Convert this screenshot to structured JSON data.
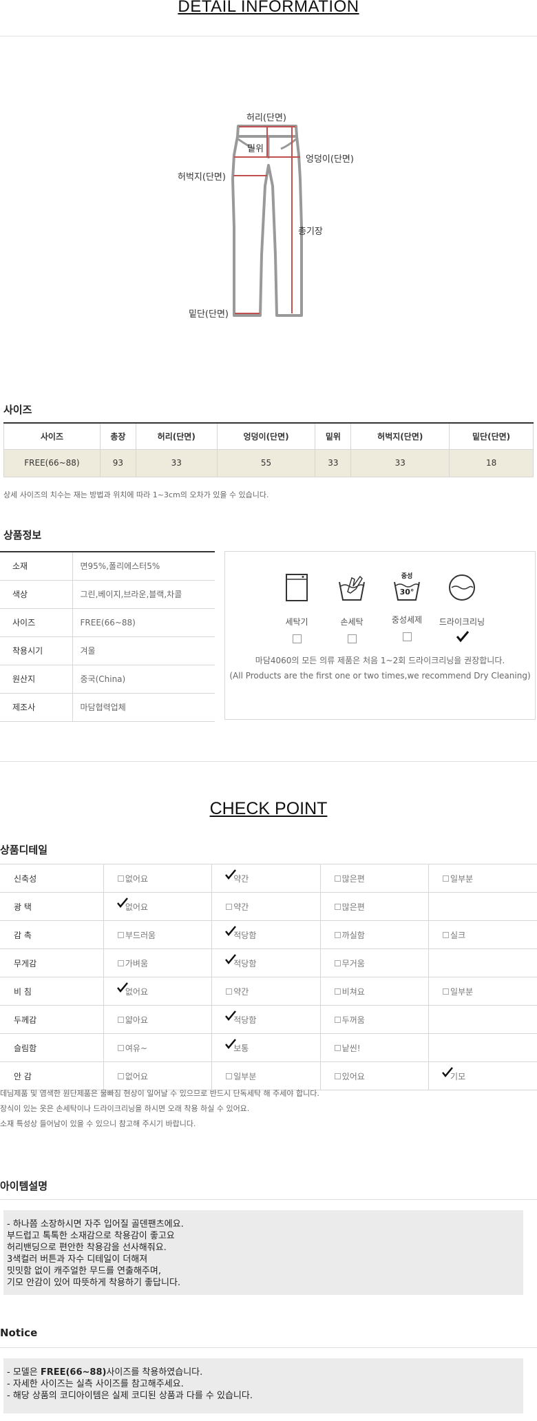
{
  "header": {
    "title": "DETAIL INFORMATION"
  },
  "diagram": {
    "labels": {
      "waist": "허리(단면)",
      "rise": "밑위",
      "hip": "엉덩이(단면)",
      "thigh": "허벅지(단면)",
      "length": "총기장",
      "hem": "밑단(단면)"
    }
  },
  "size_section": {
    "title": "사이즈",
    "headers": [
      "사이즈",
      "총장",
      "허리(단면)",
      "엉덩이(단면)",
      "밑위",
      "허벅지(단면)",
      "밑단(단면)"
    ],
    "row": [
      "FREE(66~88)",
      "93",
      "33",
      "55",
      "33",
      "33",
      "18"
    ],
    "note": "상세 사이즈의 치수는 재는 방법과 위치에 따라 1~3cm의 오차가 있을 수 있습니다."
  },
  "product_info": {
    "title": "상품정보",
    "rows": [
      {
        "key": "소재",
        "value": "면95%,폴리에스터5%"
      },
      {
        "key": "색상",
        "value": "그린,베이지,브라운,블랙,차콜"
      },
      {
        "key": "사이즈",
        "value": "FREE(66~88)"
      },
      {
        "key": "착용시기",
        "value": "겨울"
      },
      {
        "key": "원산지",
        "value": "중국(China)"
      },
      {
        "key": "제조사",
        "value": "마담협력업체"
      }
    ],
    "care": {
      "items": [
        {
          "label": "세탁기",
          "icon": "washing-machine-icon",
          "checked": false
        },
        {
          "label": "손세탁",
          "icon": "hand-wash-icon",
          "checked": false
        },
        {
          "label": "중성세제",
          "icon": "neutral-detergent-icon",
          "checked": false,
          "tag": "중성",
          "temp": "30°"
        },
        {
          "label": "드라이크리닝",
          "icon": "dry-clean-icon",
          "checked": true
        }
      ],
      "note_ko": "마담4060의 모든 의류 제품은 처음 1~2회 드라이크리닝을 권장합니다.",
      "note_en": "(All Products are the first one or two times,we recommend Dry Cleaning)"
    }
  },
  "check_point": {
    "title": "CHECK POINT",
    "subtitle": "상품디테일",
    "rows": [
      {
        "key": "신축성",
        "options": [
          "없어요",
          "약간",
          "많은편",
          "일부분"
        ],
        "checked": 1
      },
      {
        "key": "광 택",
        "options": [
          "없어요",
          "약간",
          "많은편"
        ],
        "checked": 0
      },
      {
        "key": "감 촉",
        "options": [
          "부드러움",
          "적당함",
          "까실함",
          "실크"
        ],
        "checked": 1
      },
      {
        "key": "무게감",
        "options": [
          "가벼움",
          "적당함",
          "무거움"
        ],
        "checked": 1
      },
      {
        "key": "비 침",
        "options": [
          "없어요",
          "약간",
          "비쳐요",
          "일부분"
        ],
        "checked": 0
      },
      {
        "key": "두께감",
        "options": [
          "얇아요",
          "적당함",
          "두꺼움"
        ],
        "checked": 1
      },
      {
        "key": "슬림함",
        "options": [
          "여유~",
          "보통",
          "낱씬!"
        ],
        "checked": 1
      },
      {
        "key": "안 감",
        "options": [
          "없어요",
          "일부분",
          "있어요",
          "기모"
        ],
        "checked": 3
      }
    ],
    "notes": [
      "데님제품 및 염색한 원단제품은 물빠짐 현상이 일어날 수 있으므로 반드시 단독세탁 해 주세야 합니다.",
      "장식이 있는 옷은 손세탁이나 드라이크리닝을 하시면 오래 착용 하실 수 있어요.",
      "소재 특성상 들어남이 있을 수 있으니 참고해 주시기 바랍니다."
    ]
  },
  "item_desc": {
    "title": "아이템설명",
    "lines": [
      "- 하나쯤 소장하시면 자주 입어질 골덴팬츠에요.",
      "부드럽고 톡톡한 소재감으로 착용감이 좋고요",
      "허리밴딩으로 편안한 착용감을 선사해줘요.",
      "3색컬러 버튼과 자수 디테일이 더해져",
      "밋밋함 없이 캐주얼한 무드를 연출해주며,",
      "기모 안감이 있어 따뜻하게 착용하기 좋답니다."
    ]
  },
  "notice": {
    "title": "Notice",
    "line1_pre": "- 모델은 ",
    "line1_bold": "FREE(66~88)",
    "line1_post": "사이즈를 착용하였습니다.",
    "line2": "- 자세한 사이즈는 실측 사이즈를 참고해주세요.",
    "line3": "- 해당 상품의 코디아이템은 실제 코디된 상품과 다를 수 있습니다."
  }
}
